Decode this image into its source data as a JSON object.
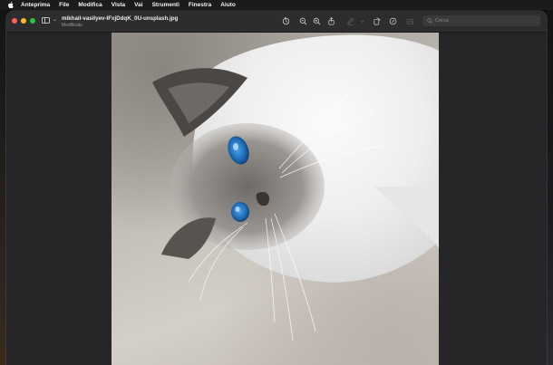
{
  "menubar": {
    "apple_icon": "apple-logo",
    "app_name": "Anteprima",
    "items": [
      "File",
      "Modifica",
      "Vista",
      "Vai",
      "Strumenti",
      "Finestra",
      "Aiuto"
    ]
  },
  "window": {
    "title": "mikhail-vasilyev-IFxjDdqK_0U-unsplash.jpg",
    "subtitle": "Modificato",
    "toolbar_icons": [
      "rotate-icon",
      "zoom-out-icon",
      "zoom-in-icon",
      "share-icon",
      "markup-pen-icon",
      "rotate-left-icon",
      "highlight-icon",
      "crop-icon"
    ],
    "search": {
      "placeholder": "Cerca",
      "value": ""
    }
  },
  "colors": {
    "close": "#fe5f57",
    "minimize": "#febc2e",
    "zoom": "#28c840"
  }
}
